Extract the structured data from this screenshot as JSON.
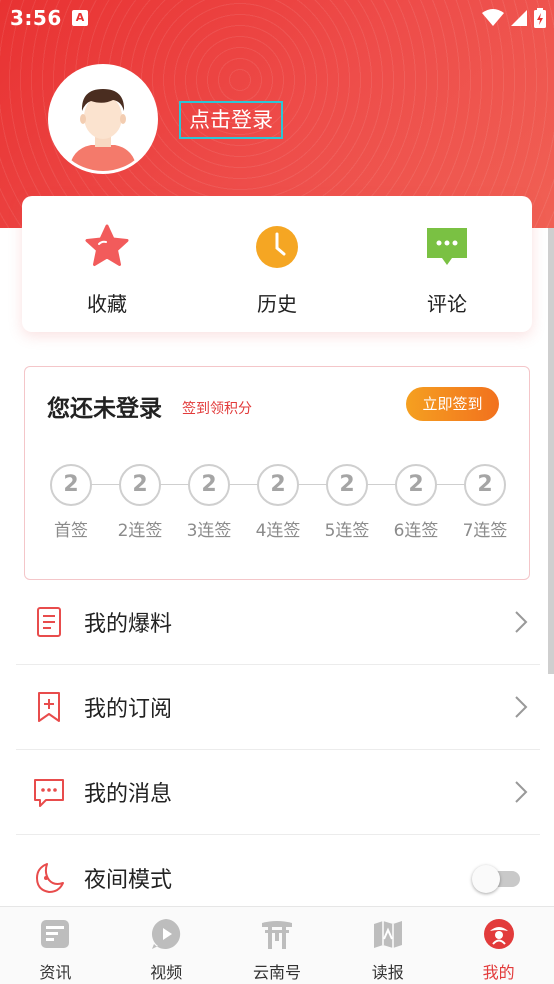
{
  "status_bar": {
    "time": "3:56",
    "app_badge": "A"
  },
  "profile": {
    "login_text": "点击登录"
  },
  "quick_actions": [
    {
      "label": "收藏",
      "icon": "star-icon",
      "color": "#f25b5b"
    },
    {
      "label": "历史",
      "icon": "clock-icon",
      "color": "#f5a623"
    },
    {
      "label": "评论",
      "icon": "comment-icon",
      "color": "#7ac143"
    }
  ],
  "checkin": {
    "title": "您还未登录",
    "subtitle": "签到领积分",
    "button_label": "立即签到",
    "days": [
      {
        "points": "2",
        "label": "首签"
      },
      {
        "points": "2",
        "label": "2连签"
      },
      {
        "points": "2",
        "label": "3连签"
      },
      {
        "points": "2",
        "label": "4连签"
      },
      {
        "points": "2",
        "label": "5连签"
      },
      {
        "points": "2",
        "label": "6连签"
      },
      {
        "points": "2",
        "label": "7连签"
      }
    ]
  },
  "menu": [
    {
      "label": "我的爆料",
      "icon": "document-icon"
    },
    {
      "label": "我的订阅",
      "icon": "bookmark-add-icon"
    },
    {
      "label": "我的消息",
      "icon": "message-icon"
    },
    {
      "label": "夜间模式",
      "icon": "moon-icon",
      "toggle": false
    }
  ],
  "bottom_nav": [
    {
      "label": "资讯",
      "icon": "news-icon",
      "active": false
    },
    {
      "label": "视频",
      "icon": "play-icon",
      "active": false
    },
    {
      "label": "云南号",
      "icon": "gate-icon",
      "active": false
    },
    {
      "label": "读报",
      "icon": "map-icon",
      "active": false
    },
    {
      "label": "我的",
      "icon": "profile-logo-icon",
      "active": true
    }
  ],
  "colors": {
    "brand_red": "#e83232",
    "accent_orange": "#f5a020",
    "highlight_cyan": "#2dc6d6"
  }
}
